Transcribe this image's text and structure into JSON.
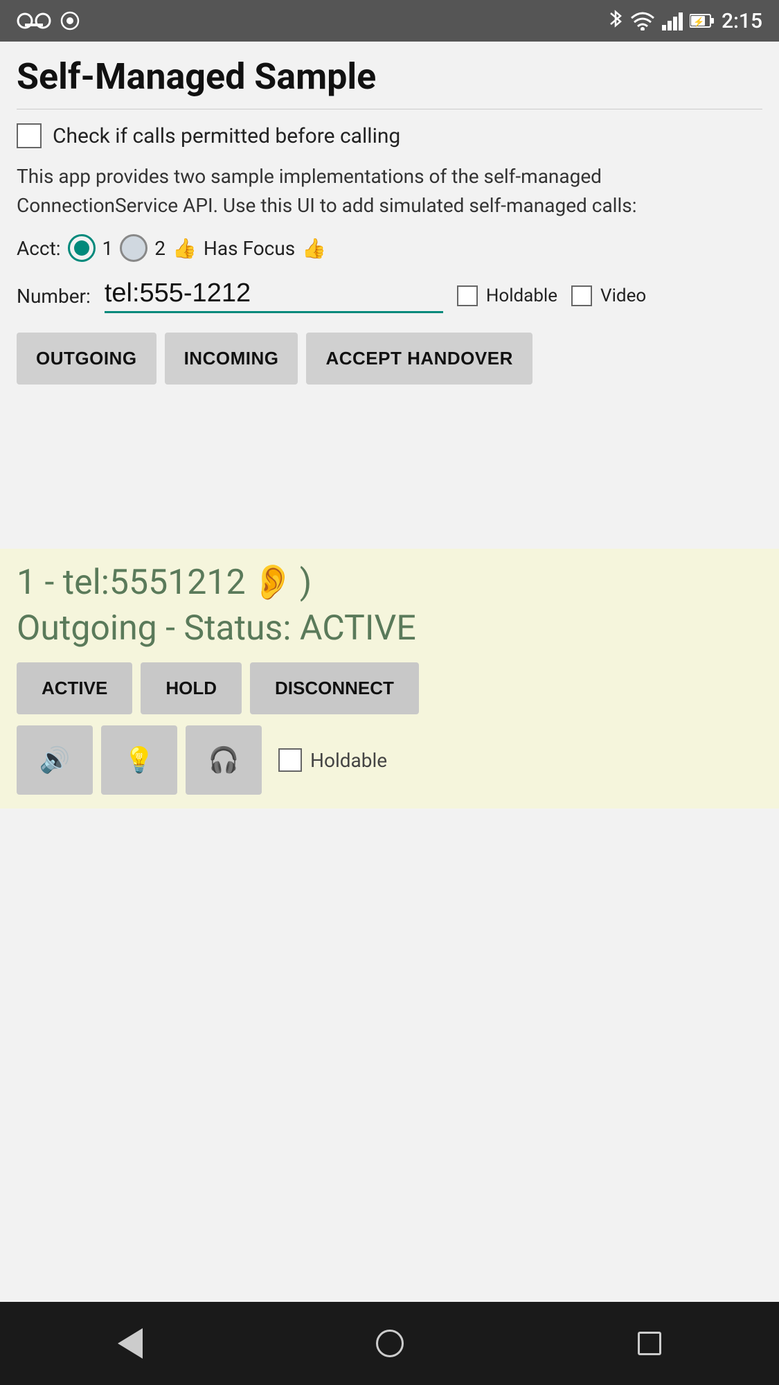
{
  "statusBar": {
    "time": "2:15",
    "icons": [
      "voicemail",
      "sync",
      "bluetooth",
      "wifi",
      "signal",
      "battery"
    ]
  },
  "app": {
    "title": "Self-Managed Sample"
  },
  "checkboxRow": {
    "label": "Check if calls permitted before calling",
    "checked": false
  },
  "description": "This app provides two sample implementations of the self-managed ConnectionService API.  Use this UI to add simulated self-managed calls:",
  "acct": {
    "label": "Acct:",
    "account1": "1",
    "account2": "2",
    "hasFocusLabel": "Has Focus",
    "thumbsUp": "👍"
  },
  "numberRow": {
    "label": "Number:",
    "value": "tel:555-1212",
    "holdableLabel": "Holdable",
    "videoLabel": "Video"
  },
  "actionButtons": {
    "outgoing": "OUTGOING",
    "incoming": "INCOMING",
    "acceptHandover": "ACCEPT HANDOVER"
  },
  "callCard": {
    "callInfo": "1 - tel:5551212",
    "earEmoji": "👂",
    "statusLine": "Outgoing - Status: ACTIVE",
    "activeBtn": "ACTIVE",
    "holdBtn": "HOLD",
    "disconnectBtn": "DISCONNECT",
    "speakerEmoji": "🔊",
    "bulbEmoji": "💡",
    "headphonesEmoji": "🎧",
    "holdableLabel": "Holdable"
  },
  "navBar": {
    "backLabel": "back",
    "homeLabel": "home",
    "recentLabel": "recent"
  }
}
